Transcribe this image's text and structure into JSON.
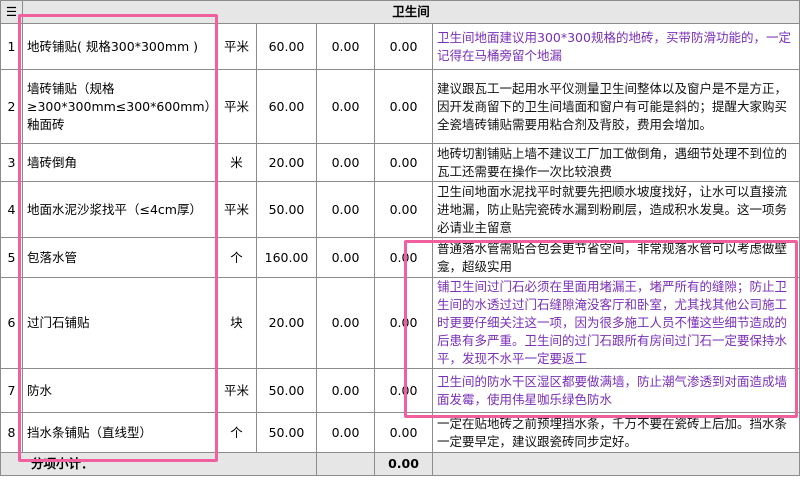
{
  "header": {
    "menu_icon": "☰",
    "title": "卫生间"
  },
  "rows": [
    {
      "no": "1",
      "name": "地砖铺贴( 规格300*300mm )",
      "unit": "平米",
      "qty": "60.00",
      "price": "0.00",
      "total": "0.00",
      "note": "卫生间地面建议用300*300规格的地砖，买带防滑功能的，一定记得在马桶旁留个地漏",
      "note_color": "purple"
    },
    {
      "no": "2",
      "name": "墙砖铺贴（规格≥300*300mm≤300*600mm）釉面砖",
      "unit": "平米",
      "qty": "60.00",
      "price": "0.00",
      "total": "0.00",
      "note": "建议跟瓦工一起用水平仪测量卫生间整体以及窗户是不是方正，因开发商留下的卫生间墙面和窗户有可能是斜的；提醒大家购买全瓷墙砖铺贴需要用粘合剂及背胶，费用会增加。",
      "note_color": "black"
    },
    {
      "no": "3",
      "name": "墙砖倒角",
      "unit": "米",
      "qty": "20.00",
      "price": "0.00",
      "total": "0.00",
      "note": "地砖切割铺贴上墙不建议工厂加工做倒角，遇细节处理不到位的瓦工还需要在操作一次比较浪费",
      "note_color": "black"
    },
    {
      "no": "4",
      "name": "地面水泥沙浆找平（≤4cm厚）",
      "unit": "平米",
      "qty": "50.00",
      "price": "0.00",
      "total": "0.00",
      "note": "卫生间地面水泥找平时就要先把顺水坡度找好，让水可以直接流进地漏，防止贴完瓷砖水漏到粉刷层，造成积水发臭。这一项务必请业主留意",
      "note_color": "black"
    },
    {
      "no": "5",
      "name": "包落水管",
      "unit": "个",
      "qty": "160.00",
      "price": "0.00",
      "total": "0.00",
      "note": "普通落水管需贴合包会更节省空间，非常规落水管可以考虑做壁龛，超级实用",
      "note_color": "black"
    },
    {
      "no": "6",
      "name": "过门石铺贴",
      "unit": "块",
      "qty": "20.00",
      "price": "0.00",
      "total": "0.00",
      "note": "铺卫生间过门石必须在里面用堵漏王，堵严所有的缝隙；防止卫生间的水透过过门石缝隙淹没客厅和卧室，尤其找其他公司施工时更要仔细关注这一项，因为很多施工人员不懂这些细节造成的后患有多严重。卫生间的过门石跟所有房间过门石一定要保持水平，发现不水平一定要返工",
      "note_color": "purple"
    },
    {
      "no": "7",
      "name": "防水",
      "unit": "平米",
      "qty": "50.00",
      "price": "0.00",
      "total": "0.00",
      "note": "卫生间的防水干区湿区都要做满墙，防止潮气渗透到对面造成墙面发霉，使用伟星咖乐绿色防水",
      "note_color": "purple"
    },
    {
      "no": "8",
      "name": "挡水条铺贴（直线型）",
      "unit": "个",
      "qty": "50.00",
      "price": "0.00",
      "total": "0.00",
      "note": "一定在贴地砖之前预埋挡水条，千万不要在瓷砖上后加。挡水条一定要早定，建议跟瓷砖同步定好。",
      "note_color": "black"
    }
  ],
  "summary": {
    "label": "分项小计：",
    "total": "0.00"
  },
  "highlight_color": "#f0609e"
}
